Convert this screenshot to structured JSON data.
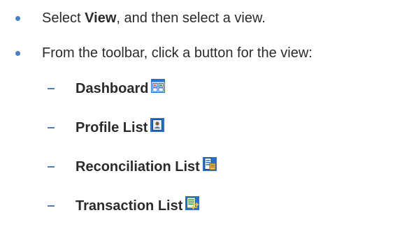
{
  "bullets": [
    {
      "pre": "Select ",
      "bold": "View",
      "post": ", and then select a view."
    },
    {
      "text": "From the toolbar, click a button for the view:"
    }
  ],
  "sub_items": [
    {
      "label": "Dashboard",
      "icon": "dashboard-icon"
    },
    {
      "label": "Profile List",
      "icon": "profile-list-icon"
    },
    {
      "label": "Reconciliation List",
      "icon": "reconciliation-list-icon"
    },
    {
      "label": "Transaction List",
      "icon": "transaction-list-icon"
    }
  ],
  "colors": {
    "text": "#2b2b2b",
    "bullet": "#4a7fc4"
  }
}
